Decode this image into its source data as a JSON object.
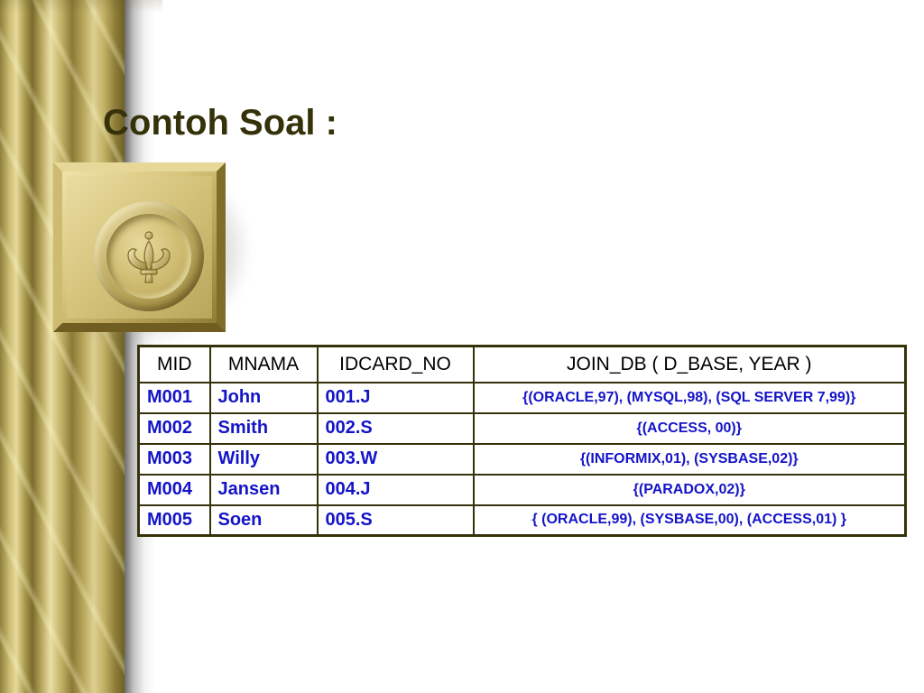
{
  "slide": {
    "title": "Contoh Soal :"
  },
  "decoration": {
    "column": "fluted-gold-column",
    "ornament": "fleur-de-lis-plaque-icon"
  },
  "table": {
    "headers": [
      "MID",
      "MNAMA",
      "IDCARD_NO",
      "JOIN_DB ( D_BASE, YEAR )"
    ],
    "rows": [
      [
        "M001",
        "John",
        "001.J",
        "{(ORACLE,97), (MYSQL,98), (SQL SERVER 7,99)}"
      ],
      [
        "M002",
        "Smith",
        "002.S",
        "{(ACCESS, 00)}"
      ],
      [
        "M003",
        "Willy",
        "003.W",
        "{(INFORMIX,01), (SYSBASE,02)}"
      ],
      [
        "M004",
        "Jansen",
        "004.J",
        "{(PARADOX,02)}"
      ],
      [
        "M005",
        "Soen",
        "005.S",
        "{ (ORACLE,99), (SYSBASE,00), (ACCESS,01) }"
      ]
    ]
  },
  "colors": {
    "title": "#35320a",
    "cell_text": "#1414c8",
    "border": "#35320a"
  }
}
